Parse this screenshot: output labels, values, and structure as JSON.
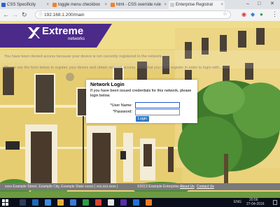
{
  "browser": {
    "tabs": [
      {
        "label": "CSS Specificity",
        "color": "#2b63c9"
      },
      {
        "label": "toggle menu checkbox",
        "color": "#f48024"
      },
      {
        "label": "html - CSS override rule",
        "color": "#f48024"
      },
      {
        "label": "Enterprise Registrat",
        "color": "#cccccc"
      }
    ],
    "window_controls": {
      "minimize": "–",
      "maximize": "□",
      "close": "✕"
    },
    "url": "192.168.1.200/main"
  },
  "brand": {
    "name": "Extreme",
    "sub": "networks"
  },
  "background_text": {
    "line1": "You have been denied access because your device is not currently registered to the network.",
    "line2": "Please use the form below to register your device and obtain network access. Note that you must register in order to login with..."
  },
  "login": {
    "title": "Network Login",
    "message": "If you have been issued credentials for this network, please login below.",
    "username_label": "*User Name:",
    "password_label": "*Password:",
    "username_value": "",
    "password_value": "",
    "button_label": "Login"
  },
  "footer": {
    "address": "xxxx Example Street, Example City, Example State xxxxx | xxx.xxx.xxxx |",
    "copyright": "©2013 Example Enterprise",
    "about": "About Us",
    "contact": "Contact Us"
  },
  "taskbar": {
    "time": "20:56",
    "date": "27-04-2016",
    "lang": "ENG"
  }
}
